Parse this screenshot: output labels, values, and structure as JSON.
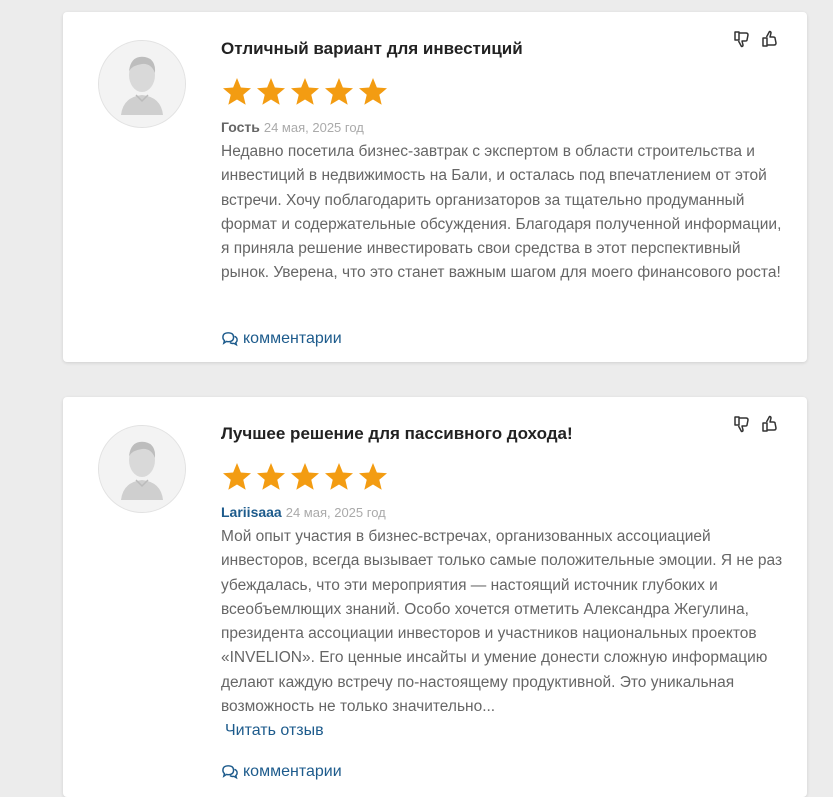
{
  "reviews": [
    {
      "title": "Отличный вариант для инвестиций",
      "rating": 5,
      "author": "Гость",
      "date": "24 мая, 2025 год",
      "text": "Недавно посетила бизнес-завтрак с экспертом в области строительства и инвестиций в недвижимость на Бали, и осталась под впечатлением от этой встречи. Хочу поблагодарить организаторов за тщательно продуманный формат и содержательные обсуждения. Благодаря полученной информации, я приняла решение инвестировать свои средства в этот перспективный рынок. Уверена, что это станет важным шагом для моего финансового роста!",
      "comments_label": "комментарии"
    },
    {
      "title": "Лучшее решение для пассивного дохода!",
      "rating": 5,
      "author": "Lariisaaa",
      "date": "24 мая, 2025 год",
      "text": "Мой опыт участия в бизнес-встречах, организованных ассоциацией инвесторов, всегда вызывает только самые положительные эмоции. Я не раз убеждалась, что эти мероприятия — настоящий источник глубоких и всеобъемлющих знаний. Особо хочется отметить Александра Жегулина, президента ассоциации инвесторов и участников национальных проектов «INVELION». Его ценные инсайты и умение донести сложную информацию делают каждую встречу по-настоящему продуктивной. Это уникальная возможность не только значительно...",
      "read_more_label": "Читать отзыв",
      "comments_label": "комментарии"
    }
  ],
  "colors": {
    "star": "#f39c12",
    "link": "#1d5b8c",
    "text": "#666666"
  },
  "icons": [
    "thumbs-down-icon",
    "thumbs-up-icon",
    "star-icon",
    "comments-icon",
    "avatar-placeholder"
  ]
}
